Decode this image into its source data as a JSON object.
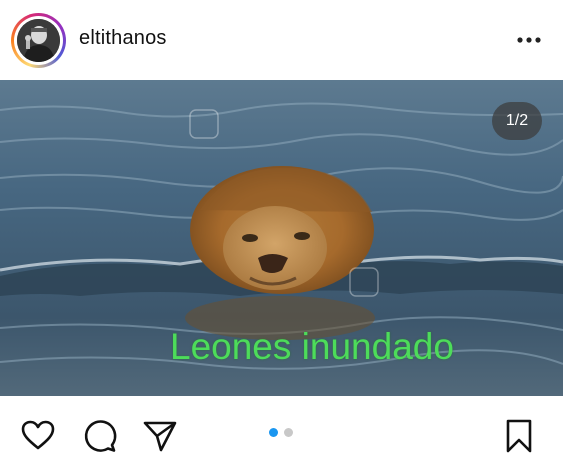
{
  "post": {
    "username": "eltithanos",
    "more_icon": "more-horizontal-icon",
    "carousel_counter": "1/2",
    "caption_overlay": "Leones inundado",
    "carousel": {
      "current": 1,
      "total": 2
    }
  },
  "actions": {
    "like_icon": "heart-icon",
    "comment_icon": "comment-icon",
    "share_icon": "send-icon",
    "save_icon": "bookmark-icon"
  },
  "colors": {
    "active_dot": "#1a96f0",
    "inactive_dot": "#c8c8c8",
    "caption_green": "#4ddc5a"
  }
}
